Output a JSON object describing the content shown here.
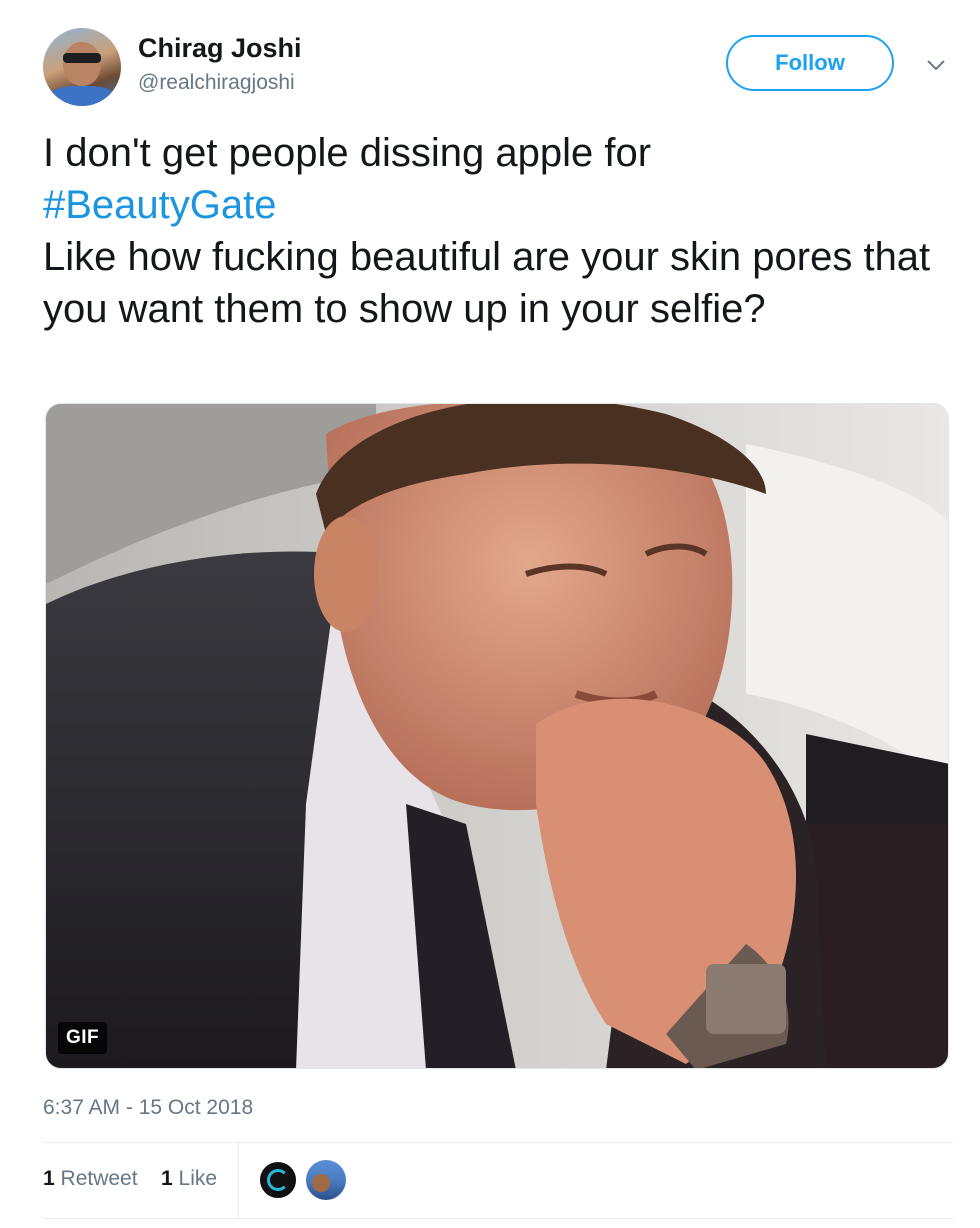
{
  "author": {
    "name": "Chirag Joshi",
    "handle": "@realchiragjoshi"
  },
  "follow_button": {
    "label": "Follow"
  },
  "tweet": {
    "line1": "I don't get people dissing apple for",
    "hashtag": "#BeautyGate",
    "line2": "Like how fucking beautiful are your skin pores that you want them to show up in your selfie?"
  },
  "media": {
    "badge": "GIF"
  },
  "timestamp": "6:37 AM - 15 Oct 2018",
  "stats": {
    "retweet_count": "1",
    "retweet_label": "Retweet",
    "like_count": "1",
    "like_label": "Like"
  },
  "colors": {
    "accent": "#1da1f2",
    "hashtag": "#1b95e0",
    "secondary_text": "#657786"
  },
  "icons": [
    "chevron-down-icon"
  ]
}
